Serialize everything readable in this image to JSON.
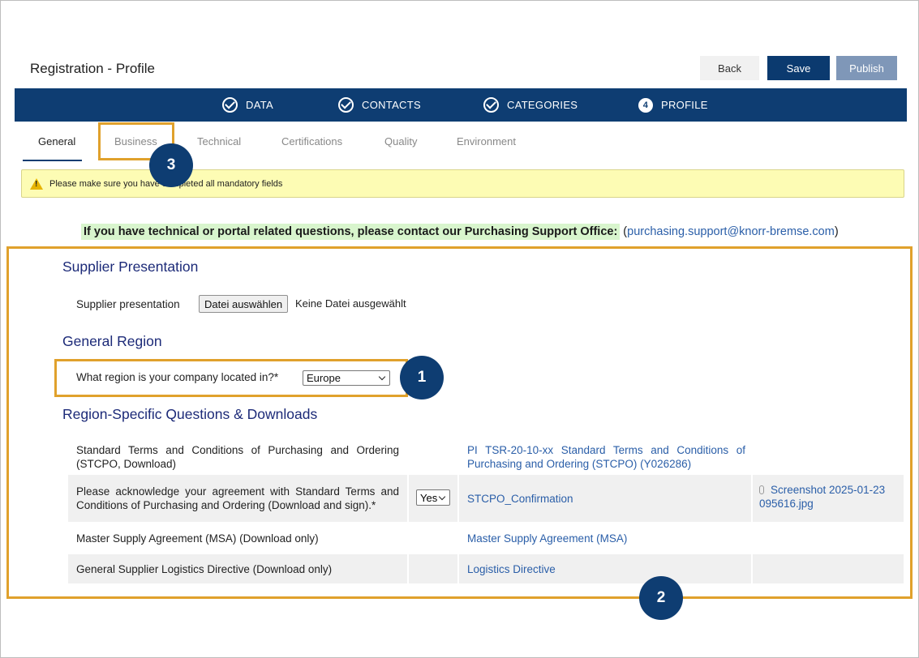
{
  "header": {
    "title": "Registration - Profile",
    "back_label": "Back",
    "save_label": "Save",
    "publish_label": "Publish"
  },
  "steps": [
    {
      "label": "DATA",
      "icon": "check-circle-icon"
    },
    {
      "label": "CONTACTS",
      "icon": "check-circle-icon"
    },
    {
      "label": "CATEGORIES",
      "icon": "check-circle-icon"
    },
    {
      "label": "PROFILE",
      "number": "4"
    }
  ],
  "tabs": [
    "General",
    "Business",
    "Technical",
    "Certifications",
    "Quality",
    "Environment"
  ],
  "warning": {
    "text_before": "Please make sure you have c",
    "text_after": "ompleted all mandatory fields",
    "icon": "warning-triangle-icon"
  },
  "contact": {
    "text": "If you have technical or portal related questions, please contact our Purchasing Support Office:",
    "open_paren": "(",
    "email": "purchasing.support@knorr-bremse.com",
    "close_paren": ")"
  },
  "supplier_presentation": {
    "title": "Supplier Presentation",
    "label": "Supplier presentation",
    "file_button": "Datei auswählen",
    "file_status": "Keine Datei ausgewählt"
  },
  "general_region": {
    "title": "General Region",
    "question": "What region is your company located in?*",
    "selected": "Europe"
  },
  "region_specific": {
    "title": "Region-Specific Questions & Downloads",
    "rows": [
      {
        "label": "Standard Terms and Conditions of Purchasing and Ordering (STCPO, Download)",
        "link": "PI TSR-20-10-xx Standard Terms and Conditions of Purchasing and Ordering (STCPO) (Y026286)"
      },
      {
        "label": "Please acknowledge your agreement with Standard Terms and Conditions of Purchasing and Ordering (Download and sign).*",
        "answer": "Yes",
        "link": "STCPO_Confirmation",
        "attachment": "Screenshot 2025-01-23 095616.jpg"
      },
      {
        "label": "Master Supply Agreement (MSA) (Download only)",
        "link": "Master Supply Agreement (MSA)"
      },
      {
        "label": "General Supplier Logistics Directive (Download only)",
        "link": "Logistics Directive"
      }
    ]
  },
  "annotations": {
    "badge_1": "1",
    "badge_2": "2",
    "badge_3": "3"
  },
  "colors": {
    "nav_blue": "#0e3d72",
    "annotation_orange": "#e0a12c",
    "link_blue": "#2a5ea8",
    "heading_navy": "#1c2a78",
    "warning_yellow": "#fdfcb4"
  }
}
